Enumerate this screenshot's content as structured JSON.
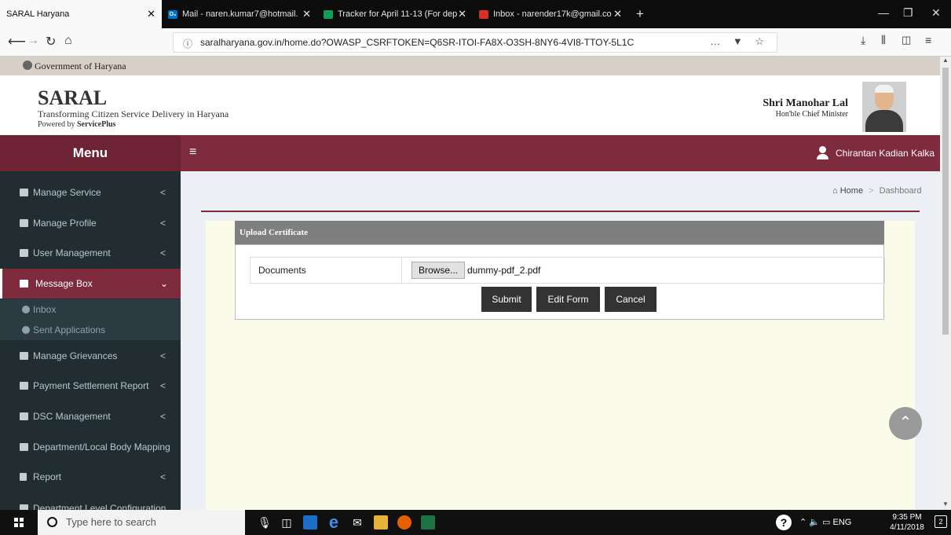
{
  "browser": {
    "tabs": [
      {
        "label": "SARAL Haryana",
        "active": true
      },
      {
        "label": "Mail - naren.kumar7@hotmail.",
        "favicon": "O₃"
      },
      {
        "label": "Tracker for April 11-13 (For dep"
      },
      {
        "label": "Inbox - narender17k@gmail.co"
      }
    ],
    "new_tab": "+",
    "url": "saralharyana.gov.in/home.do?OWASP_CSRFTOKEN=Q6SR-ITOI-FA8X-O3SH-8NY6-4VI8-TTOY-5L1C",
    "url_actions": "… ▼ ☆"
  },
  "page": {
    "gov_label": "Government of Haryana",
    "brand": "SARAL",
    "tagline": "Transforming Citizen Service Delivery in Haryana",
    "powered_prefix": "Powered by ",
    "powered_by": "ServicePlus",
    "cm_name": "Shri Manohar Lal",
    "cm_role": "Hon'ble Chief Minister",
    "menu_title": "Menu",
    "user_name": "Chirantan Kadian Kalka"
  },
  "sidebar": {
    "items": [
      {
        "label": "Manage Service",
        "chevron": "<"
      },
      {
        "label": "Manage Profile",
        "chevron": "<"
      },
      {
        "label": "User Management",
        "chevron": "<"
      },
      {
        "label": "Message Box",
        "chevron": "⌄",
        "active": true
      },
      {
        "label": "Manage Grievances",
        "chevron": "<"
      },
      {
        "label": "Payment Settlement Report",
        "chevron": "<"
      },
      {
        "label": "DSC Management",
        "chevron": "<"
      },
      {
        "label": "Department/Local Body Mapping",
        "chevron": ""
      },
      {
        "label": "Report",
        "chevron": "<"
      },
      {
        "label": "Department Level Configuration",
        "chevron": ""
      }
    ],
    "subitems": [
      {
        "label": "Inbox"
      },
      {
        "label": "Sent Applications"
      }
    ]
  },
  "breadcrumb": {
    "home": "Home",
    "current": "Dashboard"
  },
  "form": {
    "title": "Upload Certificate",
    "documents_label": "Documents",
    "browse_label": "Browse...",
    "file_name": "dummy-pdf_2.pdf",
    "submit_label": "Submit",
    "edit_label": "Edit Form",
    "cancel_label": "Cancel"
  },
  "taskbar": {
    "search_placeholder": "Type here to search",
    "language": "ENG",
    "time": "9:35 PM",
    "date": "4/11/2018",
    "notifications": "2"
  },
  "colors": {
    "brand_maroon": "#7d2b3d",
    "sidebar_bg": "#222d32",
    "panel_bg": "#fbfbe9"
  }
}
